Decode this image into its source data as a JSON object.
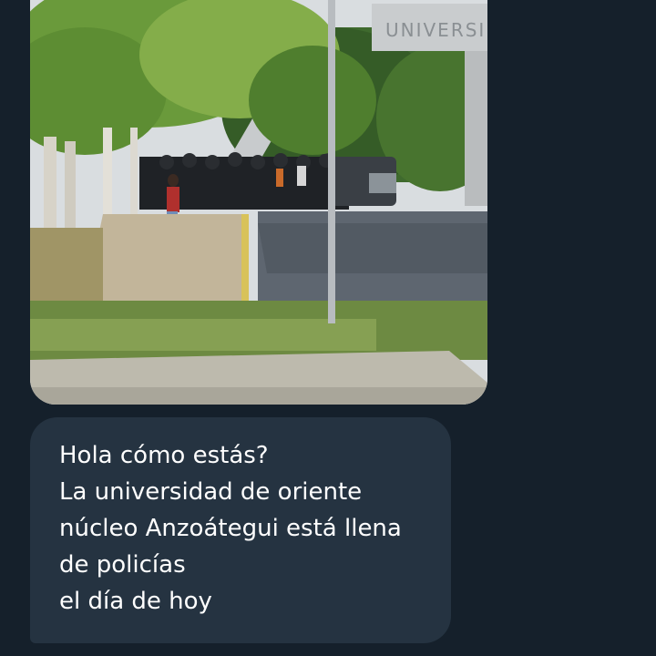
{
  "message": {
    "image_sign_text": "UNIVERSIDA",
    "image_description_icon": "photo-icon",
    "lines": [
      "Hola cómo estás?",
      "La universidad de oriente",
      "núcleo Anzoátegui está llena",
      "de policías",
      "el día de hoy"
    ]
  }
}
